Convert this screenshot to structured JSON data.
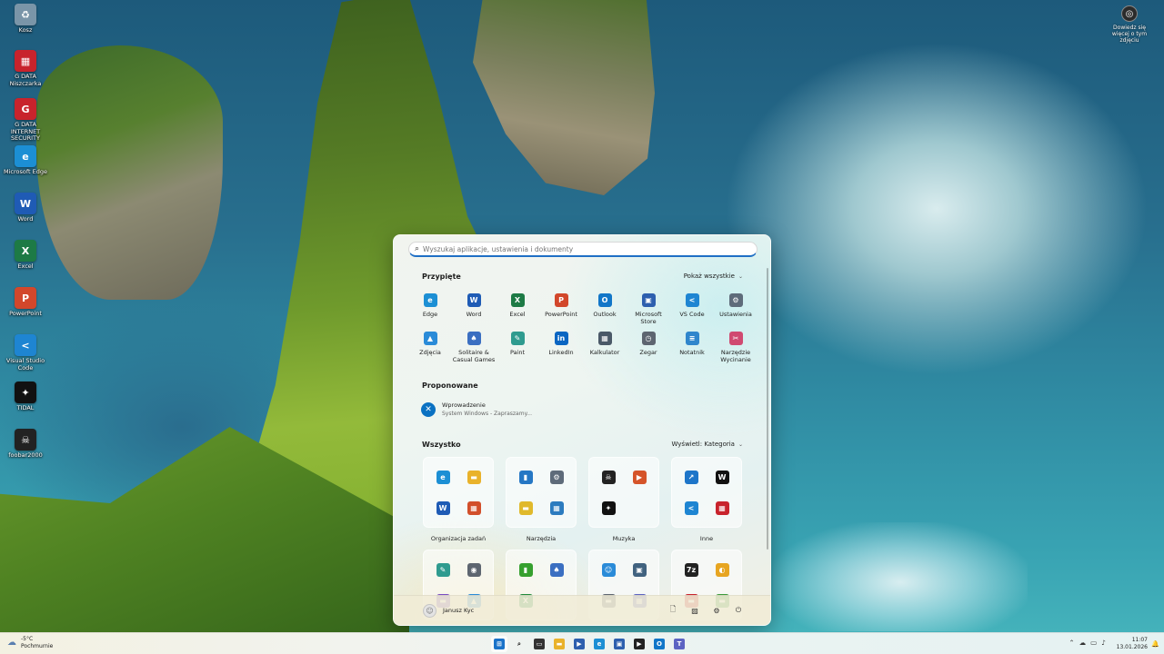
{
  "desktop": {
    "icons": [
      {
        "label": "Kosz",
        "icon": "recycle-bin-icon",
        "color": "#7a95a8",
        "glyph": "♻"
      },
      {
        "label": "G DATA Niszczarka",
        "icon": "shredder-icon",
        "color": "#c8232c",
        "glyph": "▦"
      },
      {
        "label": "G DATA INTERNET SECURITY",
        "icon": "shield-icon",
        "color": "#c8232c",
        "glyph": "G"
      },
      {
        "label": "Microsoft Edge",
        "icon": "edge-icon",
        "color": "#1c8fd4",
        "glyph": "e"
      },
      {
        "label": "Word",
        "icon": "word-icon",
        "color": "#1f5bb5",
        "glyph": "W"
      },
      {
        "label": "Excel",
        "icon": "excel-icon",
        "color": "#1d7a45",
        "glyph": "X"
      },
      {
        "label": "PowerPoint",
        "icon": "powerpoint-icon",
        "color": "#d2472b",
        "glyph": "P"
      },
      {
        "label": "Visual Studio Code",
        "icon": "vscode-icon",
        "color": "#1e85d2",
        "glyph": "<"
      },
      {
        "label": "TIDAL",
        "icon": "tidal-icon",
        "color": "#111111",
        "glyph": "✦"
      },
      {
        "label": "foobar2000",
        "icon": "foobar-icon",
        "color": "#222222",
        "glyph": "☠"
      }
    ],
    "notify": {
      "label": "Dowiedz się więcej o tym zdjęciu"
    }
  },
  "start_menu": {
    "search_placeholder": "Wyszukaj aplikacje, ustawienia i dokumenty",
    "pinned_title": "Przypięte",
    "show_all": "Pokaż wszystkie",
    "pinned": [
      {
        "label": "Edge",
        "icon": "edge-icon",
        "color": "#1c8fd4",
        "glyph": "e"
      },
      {
        "label": "Word",
        "icon": "word-icon",
        "color": "#1f5bb5",
        "glyph": "W"
      },
      {
        "label": "Excel",
        "icon": "excel-icon",
        "color": "#1d7a45",
        "glyph": "X"
      },
      {
        "label": "PowerPoint",
        "icon": "powerpoint-icon",
        "color": "#d2472b",
        "glyph": "P"
      },
      {
        "label": "Outlook",
        "icon": "outlook-icon",
        "color": "#1176c8",
        "glyph": "O"
      },
      {
        "label": "Microsoft Store",
        "icon": "store-icon",
        "color": "#2d5fae",
        "glyph": "▣"
      },
      {
        "label": "VS Code",
        "icon": "vscode-icon",
        "color": "#1e85d2",
        "glyph": "<"
      },
      {
        "label": "Ustawienia",
        "icon": "gear-icon",
        "color": "#5e6b7a",
        "glyph": "⚙"
      },
      {
        "label": "Zdjęcia",
        "icon": "photos-icon",
        "color": "#2a8bd8",
        "glyph": "▲"
      },
      {
        "label": "Solitaire & Casual Games",
        "icon": "solitaire-icon",
        "color": "#3b6fc1",
        "glyph": "♠"
      },
      {
        "label": "Paint",
        "icon": "paint-icon",
        "color": "#2f9b8f",
        "glyph": "✎"
      },
      {
        "label": "LinkedIn",
        "icon": "linkedin-icon",
        "color": "#0a66c2",
        "glyph": "in"
      },
      {
        "label": "Kalkulator",
        "icon": "calculator-icon",
        "color": "#4a5968",
        "glyph": "▦"
      },
      {
        "label": "Zegar",
        "icon": "clock-icon",
        "color": "#5d6570",
        "glyph": "◷"
      },
      {
        "label": "Notatnik",
        "icon": "notepad-icon",
        "color": "#2f86cc",
        "glyph": "≡"
      },
      {
        "label": "Narzędzie Wycinanie",
        "icon": "snipping-tool-icon",
        "color": "#d04a71",
        "glyph": "✂"
      }
    ],
    "recommended_title": "Proponowane",
    "recommended": {
      "title": "Wprowadzenie",
      "subtitle": "System Windows - Zapraszamy...",
      "icon": "get-started-icon",
      "glyph": "✕"
    },
    "all_title": "Wszystko",
    "view_label": "Wyświetl: Kategoria",
    "categories": [
      {
        "label": "Organizacja zadań",
        "icons": [
          {
            "name": "edge-icon",
            "color": "#1c8fd4",
            "glyph": "e"
          },
          {
            "name": "file-explorer-icon",
            "color": "#e9b22b",
            "glyph": "▬"
          },
          {
            "name": "word-icon",
            "color": "#1f5bb5",
            "glyph": "W"
          },
          {
            "name": "office-icon",
            "color": "#d24f2b",
            "glyph": "▦"
          }
        ]
      },
      {
        "label": "Narzędzia",
        "icons": [
          {
            "name": "quick-assist-icon",
            "color": "#2577c4",
            "glyph": "▮"
          },
          {
            "name": "gear-icon",
            "color": "#5e6b7a",
            "glyph": "⚙"
          },
          {
            "name": "sticky-notes-icon",
            "color": "#e0b92b",
            "glyph": "▬"
          },
          {
            "name": "control-panel-icon",
            "color": "#2c7bbf",
            "glyph": "▦"
          }
        ]
      },
      {
        "label": "Muzyka",
        "icons": [
          {
            "name": "foobar-icon",
            "color": "#222222",
            "glyph": "☠"
          },
          {
            "name": "media-player-icon",
            "color": "#d5542a",
            "glyph": "▶"
          },
          {
            "name": "tidal-icon",
            "color": "#111111",
            "glyph": "✦"
          },
          {
            "name": "empty-slot-icon",
            "color": "",
            "glyph": ""
          }
        ]
      },
      {
        "label": "Inne",
        "icons": [
          {
            "name": "link-icon",
            "color": "#1d75c9",
            "glyph": "↗"
          },
          {
            "name": "waves-icon",
            "color": "#111111",
            "glyph": "W"
          },
          {
            "name": "vscode-icon",
            "color": "#1e85d2",
            "glyph": "<"
          },
          {
            "name": "gdata-icon",
            "color": "#c8232c",
            "glyph": "▦"
          }
        ]
      }
    ],
    "categories_row2": [
      {
        "icons": [
          {
            "name": "paint-icon",
            "color": "#2f9b8f",
            "glyph": "✎"
          },
          {
            "name": "camera-icon",
            "color": "#5d6570",
            "glyph": "◉"
          },
          {
            "name": "clipchamp-icon",
            "color": "#7a4cc2",
            "glyph": "▬"
          },
          {
            "name": "photos-icon",
            "color": "#2a8bd8",
            "glyph": "▲"
          }
        ]
      },
      {
        "icons": [
          {
            "name": "xbox-game-icon",
            "color": "#36a02e",
            "glyph": "▮"
          },
          {
            "name": "solitaire-icon",
            "color": "#3b6fc1",
            "glyph": "♠"
          },
          {
            "name": "xbox-icon",
            "color": "#1f8a3a",
            "glyph": "X"
          },
          {
            "name": "empty-slot-icon",
            "color": "",
            "glyph": ""
          }
        ]
      },
      {
        "icons": [
          {
            "name": "people-icon",
            "color": "#2a8bd8",
            "glyph": "☺"
          },
          {
            "name": "remote-desktop-icon",
            "color": "#41627f",
            "glyph": "▣"
          },
          {
            "name": "phone-link-icon",
            "color": "#5d6570",
            "glyph": "▬"
          },
          {
            "name": "teams-icon",
            "color": "#5c63c2",
            "glyph": "▦"
          }
        ]
      },
      {
        "icons": [
          {
            "name": "7zip-icon",
            "color": "#222222",
            "glyph": "7z"
          },
          {
            "name": "sun-icon",
            "color": "#e7a521",
            "glyph": "◐"
          },
          {
            "name": "red-app-icon",
            "color": "#c8232c",
            "glyph": "▬"
          },
          {
            "name": "green-app-icon",
            "color": "#3c9a3a",
            "glyph": "▬"
          }
        ]
      }
    ],
    "user_name": "Janusz Kyc"
  },
  "taskbar": {
    "weather_temp": "-5°C",
    "weather_desc": "Pochmurnie",
    "time": "11:07",
    "date": "13.01.2026",
    "apps": [
      {
        "name": "start-button",
        "color": "#1a73c9",
        "glyph": "⊞",
        "active": true
      },
      {
        "name": "search-icon",
        "color": "",
        "glyph": "⌕"
      },
      {
        "name": "task-view-icon",
        "color": "#333333",
        "glyph": "▭"
      },
      {
        "name": "file-explorer-icon",
        "color": "#e9b22b",
        "glyph": "▬"
      },
      {
        "name": "media-player-icon",
        "color": "#2d5fae",
        "glyph": "▶"
      },
      {
        "name": "edge-icon",
        "color": "#1c8fd4",
        "glyph": "e"
      },
      {
        "name": "store-icon",
        "color": "#2d5fae",
        "glyph": "▣"
      },
      {
        "name": "foobar-icon",
        "color": "#222222",
        "glyph": "▶"
      },
      {
        "name": "outlook-icon",
        "color": "#1176c8",
        "glyph": "O"
      },
      {
        "name": "teams-icon",
        "color": "#5c63c2",
        "glyph": "T"
      }
    ]
  }
}
